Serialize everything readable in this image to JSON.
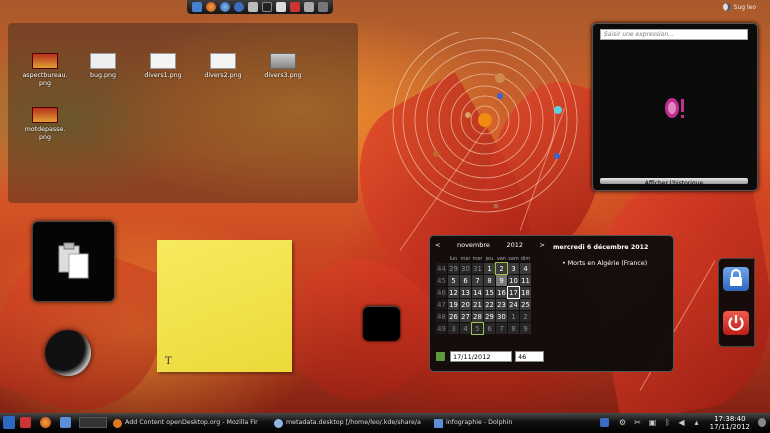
{
  "top_panel": {
    "user_name": "Sug leo",
    "app_icons": [
      "firefox-icon",
      "thunderbird-icon",
      "browser-icon",
      "settings-icon",
      "terminal-icon",
      "files-icon",
      "network-icon",
      "image-icon",
      "tools-icon"
    ]
  },
  "desktop_files": [
    {
      "name": "aspectbureau.\npng",
      "kind": "image"
    },
    {
      "name": "bug.png",
      "kind": "screenshot"
    },
    {
      "name": "divers1.png",
      "kind": "screenshot"
    },
    {
      "name": "divers2.png",
      "kind": "screenshot"
    },
    {
      "name": "divers3.png",
      "kind": "screenshot"
    },
    {
      "name": "motdepasse.\npng",
      "kind": "image"
    }
  ],
  "search_widget": {
    "placeholder": "Saisir une expression...",
    "history_button": "Afficher l'historique"
  },
  "calendar": {
    "prev": "<",
    "month": "novembre",
    "year": "2012",
    "next": ">",
    "weekday_headers": [
      "lun",
      "mar",
      "mer",
      "jeu",
      "ven",
      "sam",
      "dim"
    ],
    "weeks": [
      {
        "num": "44",
        "days": [
          "29",
          "30",
          "31",
          "1",
          "2",
          "3",
          "4"
        ]
      },
      {
        "num": "45",
        "days": [
          "5",
          "6",
          "7",
          "8",
          "9",
          "10",
          "11"
        ]
      },
      {
        "num": "46",
        "days": [
          "12",
          "13",
          "14",
          "15",
          "16",
          "17",
          "18"
        ]
      },
      {
        "num": "47",
        "days": [
          "19",
          "20",
          "21",
          "22",
          "23",
          "24",
          "25"
        ]
      },
      {
        "num": "48",
        "days": [
          "26",
          "27",
          "28",
          "29",
          "30",
          "1",
          "2"
        ]
      },
      {
        "num": "49",
        "days": [
          "3",
          "4",
          "5",
          "6",
          "7",
          "8",
          "9"
        ]
      }
    ],
    "event_title": "mercredi 6 décembre 2012",
    "event_item": "Morts en Algérie (France)",
    "date_value": "17/11/2012",
    "week_value": "46"
  },
  "taskbar": {
    "tasks": [
      {
        "label": "Add Content openDesktop.org - Mozilla Fir",
        "color": "#e07a20"
      },
      {
        "label": "metadata.desktop [/home/leo/.kde/share/a",
        "color": "#8fb6e0"
      },
      {
        "label": "infographie - Dolphin",
        "color": "#5b8fd8"
      }
    ],
    "time": "17:38:40",
    "date": "17/11/2012"
  },
  "colors": {
    "accent_green": "#9ac44a",
    "lock_blue": "#3f7fd0",
    "logout_red": "#d3322a",
    "note_yellow": "#f2e24a"
  }
}
